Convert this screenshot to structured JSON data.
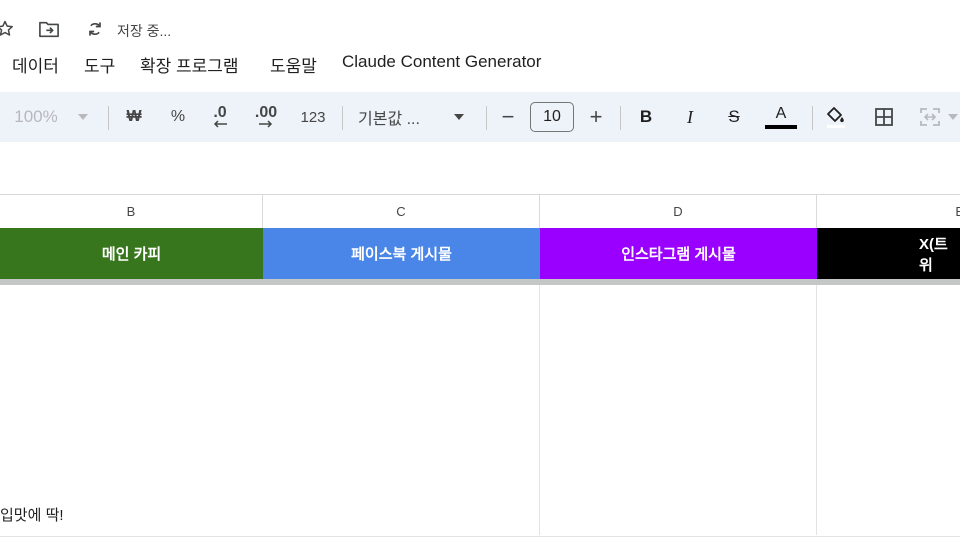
{
  "title_bar": {
    "save_status": "저장 중..."
  },
  "menu": {
    "items": [
      "데이터",
      "도구",
      "확장 프로그램",
      "도움말",
      "Claude Content Generator"
    ]
  },
  "toolbar": {
    "zoom": "100%",
    "currency": "₩",
    "percent": "%",
    "decrease_decimal": ".0",
    "increase_decimal": ".00",
    "number_format": "123",
    "font_name": "기본값 ...",
    "font_size_minus": "−",
    "font_size": "10",
    "font_size_plus": "+",
    "bold": "B",
    "italic": "I",
    "strikethrough": "S",
    "text_color_letter": "A"
  },
  "columns": [
    "B",
    "C",
    "D",
    "E"
  ],
  "header_cells": [
    {
      "text": "메인 카피",
      "bg": "#38761d"
    },
    {
      "text": "페이스북 게시물",
      "bg": "#4a86e8"
    },
    {
      "text": "인스타그램 게시물",
      "bg": "#9900ff"
    },
    {
      "text": "X(트위",
      "bg": "#000000"
    }
  ],
  "cells": {
    "b_row_text": "입맛에 딱!"
  },
  "colors": {
    "toolbar_bg": "#eef2f9",
    "text_color_bar": "#000000"
  }
}
